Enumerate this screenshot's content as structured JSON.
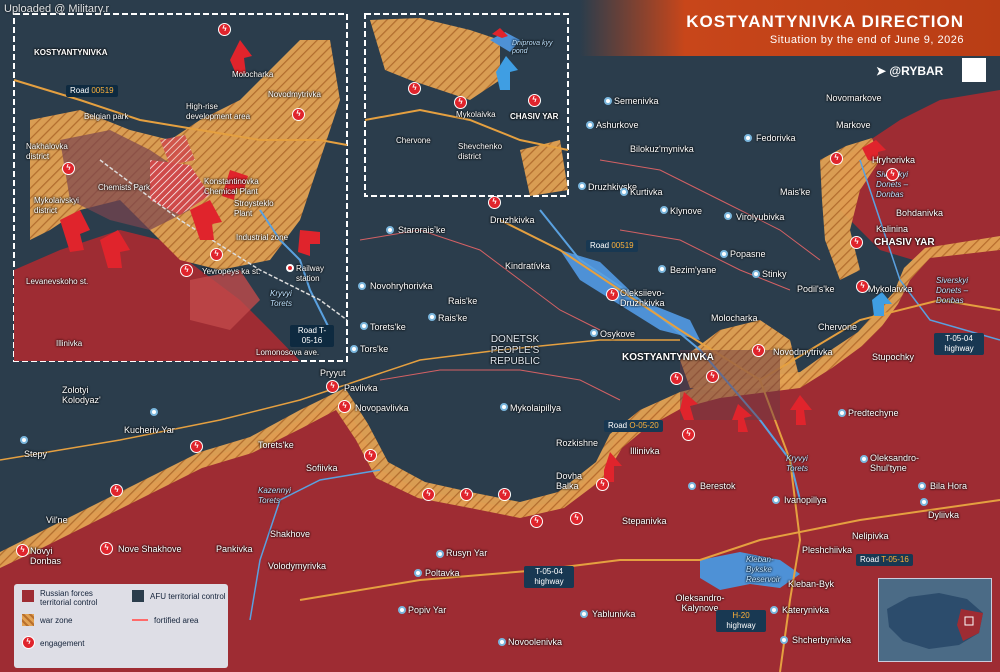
{
  "watermark": "Uploaded @ Military.r",
  "header": {
    "title": "KOSTYANTYNIVKA DIRECTION",
    "subtitle": "Situation by the end of June 9, 2026"
  },
  "brand": {
    "name": "@RYBAR",
    "icon": "telegram-icon"
  },
  "colors": {
    "russian": "#9e2c33",
    "afu": "#2b3d4c",
    "war_zone": "#e2a253",
    "engagement": "#e0242c",
    "header": "#c8461a",
    "road_tag": "#183852"
  },
  "map": {
    "region": "DONETSK PEOPLE'S REPUBLIC",
    "settlements": [
      {
        "name": "Semenivka"
      },
      {
        "name": "Novomarkove"
      },
      {
        "name": "Ashurkove"
      },
      {
        "name": "Markove"
      },
      {
        "name": "Fedorivka"
      },
      {
        "name": "Bilokuz'mynivka"
      },
      {
        "name": "Hryhorivka"
      },
      {
        "name": "Druzhkivske"
      },
      {
        "name": "Mais'ke"
      },
      {
        "name": "Kurtivka"
      },
      {
        "name": "Bohdanivka"
      },
      {
        "name": "Virolyubivka"
      },
      {
        "name": "Klynove"
      },
      {
        "name": "Kalinina"
      },
      {
        "name": "CHASIV YAR"
      },
      {
        "name": "Druzhkivka"
      },
      {
        "name": "Staroraisʼke"
      },
      {
        "name": "Kindratívka"
      },
      {
        "name": "Popasne"
      },
      {
        "name": "Bezim'yane"
      },
      {
        "name": "Stinky"
      },
      {
        "name": "Novohryhorivka"
      },
      {
        "name": "Podil's'ke"
      },
      {
        "name": "Mykolaivka"
      },
      {
        "name": "Rais'ke"
      },
      {
        "name": "Oleksiievo-Druzhkivka"
      },
      {
        "name": "Torets'ke"
      },
      {
        "name": "Rais'ke"
      },
      {
        "name": "Chervone"
      },
      {
        "name": "Osykove"
      },
      {
        "name": "Molocharka"
      },
      {
        "name": "Stupochky"
      },
      {
        "name": "Tors'ke"
      },
      {
        "name": "KOSTYANTYNIVKA"
      },
      {
        "name": "Novodmytrivka"
      },
      {
        "name": "Pryyut"
      },
      {
        "name": "Pavlivka"
      },
      {
        "name": "Predtechyne"
      },
      {
        "name": "Novopavlivka"
      },
      {
        "name": "Zolotyi Kolodyaz'"
      },
      {
        "name": "Mykolaipillya"
      },
      {
        "name": "Kucheriv Yar"
      },
      {
        "name": "Torets'ke"
      },
      {
        "name": "Rozkishne"
      },
      {
        "name": "Illinivka"
      },
      {
        "name": "Oleksandro-Shul'tyne"
      },
      {
        "name": "Stepy"
      },
      {
        "name": "Sofiivka"
      },
      {
        "name": "Dovha Balka"
      },
      {
        "name": "Berestok"
      },
      {
        "name": "Bila Hora"
      },
      {
        "name": "Ivanopillya"
      },
      {
        "name": "Vil'ne"
      },
      {
        "name": "Shakhove"
      },
      {
        "name": "Stepanivka"
      },
      {
        "name": "Dyliivka"
      },
      {
        "name": "Nelipivka"
      },
      {
        "name": "Novyi Donbas"
      },
      {
        "name": "Nove Shakhove"
      },
      {
        "name": "Pankivka"
      },
      {
        "name": "Pleshchiivka"
      },
      {
        "name": "Volodymyrivka"
      },
      {
        "name": "Rusyn Yar"
      },
      {
        "name": "Poltavka"
      },
      {
        "name": "Kleban-Byk"
      },
      {
        "name": "Oleksandro-Kalynove"
      },
      {
        "name": "Popiv Yar"
      },
      {
        "name": "Yablunivka"
      },
      {
        "name": "Katerynivka"
      },
      {
        "name": "Novoolenivka"
      },
      {
        "name": "Shcherbynivka"
      }
    ],
    "rivers": [
      "Kryvyi Torets",
      "Kazennyi Torets",
      "Siverskyi Donets – Donbas",
      "Siverskyi Donets – Donbas",
      "Kleban-Bykske Reservoir"
    ],
    "roads": [
      {
        "prefix": "Road",
        "code": "00519"
      },
      {
        "prefix": "Road",
        "code": "O-05-20"
      },
      {
        "prefix": "Road",
        "code": "T-05-16"
      },
      {
        "prefix": "T-05-04",
        "code": "highway"
      },
      {
        "prefix": "T-05-04",
        "code": "highway"
      },
      {
        "prefix": "H-20",
        "code": "highway"
      }
    ]
  },
  "inset_left": {
    "labels": [
      "KOSTYANTYNIVKA",
      "Molocharka",
      "Novodmytrivka",
      "High-rise development area",
      "Belgian park",
      "Nakhalovka district",
      "Chemists Park",
      "Konstantinovka Chemical Plant",
      "Mykolaivskyi district",
      "Stroysteklo Plant",
      "Industrial zone",
      "Yevropeys ka st.",
      "Railway station",
      "Levanevskoho st.",
      "Kryvyi Torets",
      "Illinivka",
      "Lomonosova ave."
    ],
    "road_a": {
      "prefix": "Road",
      "code": "00519"
    },
    "road_b": {
      "prefix": "Road",
      "code": "T-05-16"
    }
  },
  "inset_top": {
    "labels": [
      "Mykolaivka",
      "CHASIV YAR",
      "Chervone",
      "Shevchenko district",
      "Dniprova kyy pond"
    ]
  },
  "legend": {
    "russian": "Russian forces territorial control",
    "afu": "AFU territorial control",
    "war_zone": "war zone",
    "fortified": "fortified area",
    "engagement": "engagement"
  }
}
